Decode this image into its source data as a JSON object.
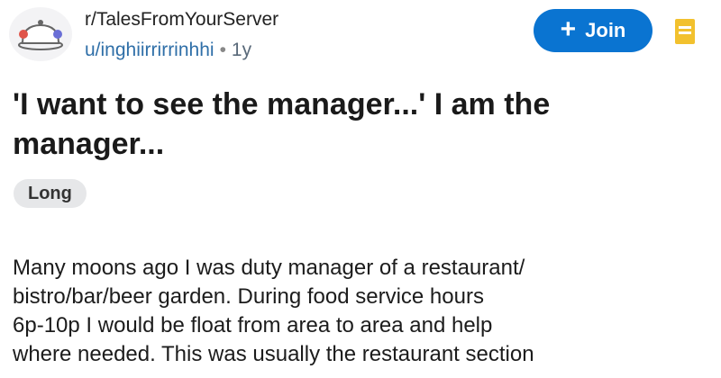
{
  "post": {
    "subreddit": "r/TalesFromYourServer",
    "username": "u/inghiirrirrinhhi",
    "age": "1y",
    "join_label": "Join",
    "title": "'I want to see the manager...' I am the manager...",
    "flair": "Long",
    "body_lines": [
      "Many moons ago I was duty manager of a restaurant/",
      "bistro/bar/beer garden.  During food service hours",
      "6p-10p I would be float from area to area and help",
      "where needed. This was usually the restaurant section"
    ]
  },
  "icons": {
    "subreddit_avatar": "serving-cloche-icon",
    "join_plus": "plus-icon",
    "save": "bookmark-save-icon"
  },
  "colors": {
    "accent": "#0a74d1",
    "save_icon": "#f2c12e",
    "username": "#2f6fa8"
  }
}
